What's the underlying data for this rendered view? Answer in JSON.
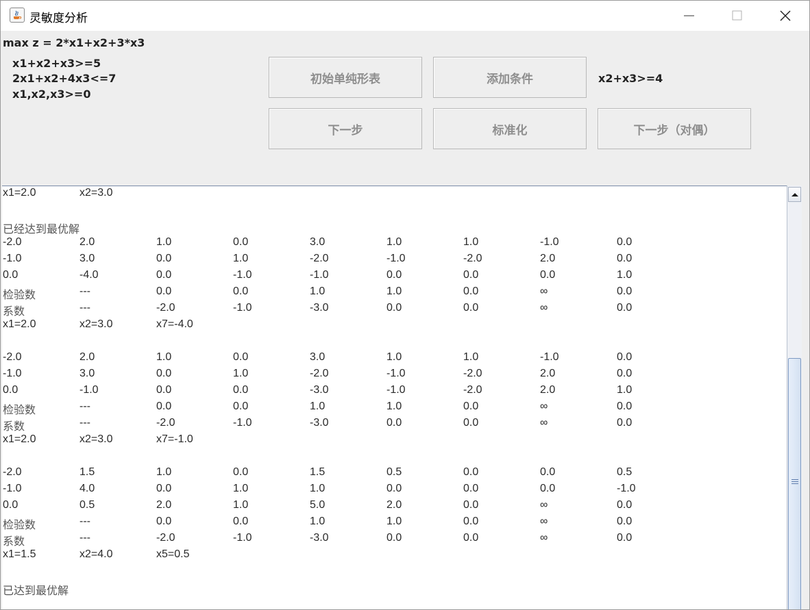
{
  "window": {
    "title": "灵敏度分析",
    "controls": [
      "minimize-icon",
      "maximize-icon",
      "close-icon"
    ]
  },
  "problem": {
    "objective": "max z = 2*x1+x2+3*x3",
    "constraints": [
      "x1+x2+x3>=5",
      "2x1+x2+4x3<=7",
      "x1,x2,x3>=0"
    ]
  },
  "buttons": {
    "initial_table": "初始单纯形表",
    "add_condition": "添加条件",
    "next_step": "下一步",
    "standardize": "标准化",
    "next_step_dual": "下一步（对偶）"
  },
  "added_constraint": "x2+x3>=4",
  "output_lines": [
    {
      "cells": [
        "x1=2.0",
        "x2=3.0"
      ]
    },
    {
      "cells": []
    },
    {
      "message": "已经达到最优解"
    },
    {
      "cells": [
        "-2.0",
        "2.0",
        "1.0",
        "0.0",
        "3.0",
        "1.0",
        "1.0",
        "-1.0",
        "0.0"
      ]
    },
    {
      "cells": [
        "-1.0",
        "3.0",
        "0.0",
        "1.0",
        "-2.0",
        "-1.0",
        "-2.0",
        "2.0",
        "0.0"
      ]
    },
    {
      "cells": [
        "0.0",
        "-4.0",
        "0.0",
        "-1.0",
        "-1.0",
        "0.0",
        "0.0",
        "0.0",
        "1.0"
      ]
    },
    {
      "cells": [
        "检验数",
        "---",
        "0.0",
        "0.0",
        "1.0",
        "1.0",
        "0.0",
        "∞",
        "0.0"
      ]
    },
    {
      "cells": [
        "系数",
        "---",
        "-2.0",
        "-1.0",
        "-3.0",
        "0.0",
        "0.0",
        "∞",
        "0.0"
      ]
    },
    {
      "cells": [
        "x1=2.0",
        "x2=3.0",
        "x7=-4.0"
      ]
    },
    {
      "cells": []
    },
    {
      "cells": [
        "-2.0",
        "2.0",
        "1.0",
        "0.0",
        "3.0",
        "1.0",
        "1.0",
        "-1.0",
        "0.0"
      ]
    },
    {
      "cells": [
        "-1.0",
        "3.0",
        "0.0",
        "1.0",
        "-2.0",
        "-1.0",
        "-2.0",
        "2.0",
        "0.0"
      ]
    },
    {
      "cells": [
        "0.0",
        "-1.0",
        "0.0",
        "0.0",
        "-3.0",
        "-1.0",
        "-2.0",
        "2.0",
        "1.0"
      ]
    },
    {
      "cells": [
        "检验数",
        "---",
        "0.0",
        "0.0",
        "1.0",
        "1.0",
        "0.0",
        "∞",
        "0.0"
      ]
    },
    {
      "cells": [
        "系数",
        "---",
        "-2.0",
        "-1.0",
        "-3.0",
        "0.0",
        "0.0",
        "∞",
        "0.0"
      ]
    },
    {
      "cells": [
        "x1=2.0",
        "x2=3.0",
        "x7=-1.0"
      ]
    },
    {
      "cells": []
    },
    {
      "cells": [
        "-2.0",
        "1.5",
        "1.0",
        "0.0",
        "1.5",
        "0.5",
        "0.0",
        "0.0",
        "0.5"
      ]
    },
    {
      "cells": [
        "-1.0",
        "4.0",
        "0.0",
        "1.0",
        "1.0",
        "0.0",
        "0.0",
        "0.0",
        "-1.0"
      ]
    },
    {
      "cells": [
        "0.0",
        "0.5",
        "2.0",
        "1.0",
        "5.0",
        "2.0",
        "0.0",
        "∞",
        "0.0"
      ]
    },
    {
      "cells": [
        "检验数",
        "---",
        "0.0",
        "0.0",
        "1.0",
        "1.0",
        "0.0",
        "∞",
        "0.0"
      ]
    },
    {
      "cells": [
        "系数",
        "---",
        "-2.0",
        "-1.0",
        "-3.0",
        "0.0",
        "0.0",
        "∞",
        "0.0"
      ]
    },
    {
      "cells": [
        "x1=1.5",
        "x2=4.0",
        "x5=0.5"
      ]
    },
    {
      "cells": []
    },
    {
      "message": "已达到最优解"
    }
  ],
  "scroll": {
    "position": 0.42,
    "visible_fraction": 0.6
  }
}
